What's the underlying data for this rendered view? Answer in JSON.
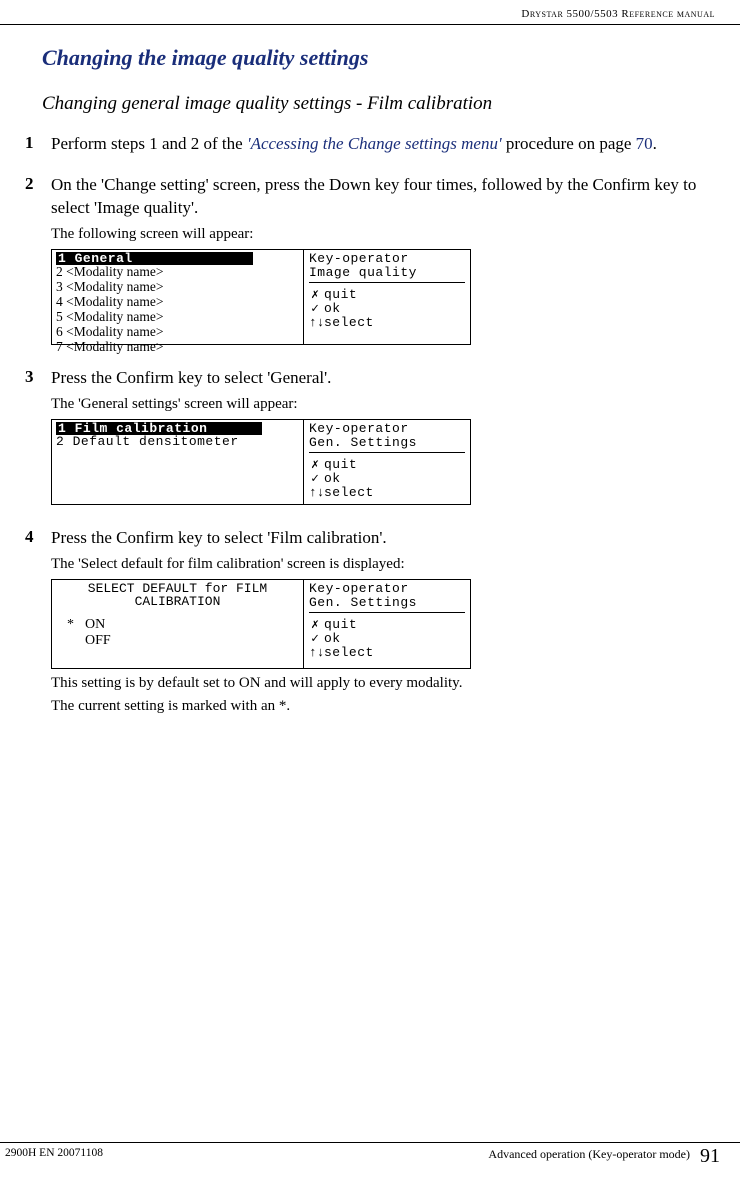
{
  "header": {
    "doc_title": "Drystar 5500/5503 Reference manual"
  },
  "section": {
    "title": "Changing the image quality settings",
    "subtitle": "Changing general image quality settings - Film calibration"
  },
  "steps": {
    "s1": {
      "num": "1",
      "prefix": "Perform steps 1 and 2 of the ",
      "link": "'Accessing the Change settings menu'",
      "mid": " procedure on page ",
      "page": "70",
      "suffix": "."
    },
    "s2": {
      "num": "2",
      "text": "On the 'Change setting' screen, press the Down key four times, followed by the Confirm key to select 'Image quality'.",
      "sub": "The following screen will appear:"
    },
    "s3": {
      "num": "3",
      "text": "Press the Confirm key to select 'General'.",
      "sub": "The 'General settings' screen will appear:"
    },
    "s4": {
      "num": "4",
      "text": "Press the Confirm key to select 'Film calibration'.",
      "sub": "The 'Select default for film calibration' screen is displayed:",
      "note1": "This setting is by default set to ON and will apply to every modality.",
      "note2": "The current setting is marked with an *."
    }
  },
  "screen1": {
    "left": {
      "sel": "1 General",
      "items": [
        "2 <Modality name>",
        "3 <Modality name>",
        "4 <Modality name>",
        "5 <Modality name>",
        "6 <Modality name>",
        "7 <Modality name>"
      ]
    },
    "right": {
      "line1": " Key-operator",
      "line2": "Image quality",
      "m1": "quit",
      "m2": "ok",
      "m3": "select"
    }
  },
  "screen2": {
    "left": {
      "sel": "1 Film calibration",
      "item": "2 Default densitometer"
    },
    "right": {
      "line1": " Key-operator",
      "line2": "Gen. Settings",
      "m1": "quit",
      "m2": "ok",
      "m3": "select"
    }
  },
  "screen3": {
    "left": {
      "title1": "SELECT DEFAULT for FILM",
      "title2": "CALIBRATION",
      "opt1_mark": "*",
      "opt1": "ON",
      "opt2": "OFF"
    },
    "right": {
      "line1": " Key-operator",
      "line2": "Gen. Settings",
      "m1": "quit",
      "m2": "ok",
      "m3": "select"
    }
  },
  "footer": {
    "left": "2900H EN 20071108",
    "center": "Advanced operation (Key-operator mode)",
    "right": "91"
  }
}
